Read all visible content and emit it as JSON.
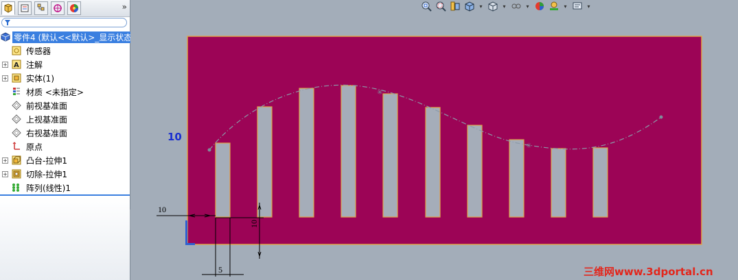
{
  "panel": {
    "tabs": [
      {
        "name": "featuremanager-tab-icon"
      },
      {
        "name": "propertymanager-tab-icon"
      },
      {
        "name": "configurationmanager-tab-icon"
      },
      {
        "name": "dimxpertmanager-tab-icon"
      },
      {
        "name": "displaymanager-tab-icon"
      }
    ],
    "more": "»",
    "tree": [
      {
        "label": "零件4 (默认<<默认>_显示状态",
        "icon": "part-icon",
        "selected": true,
        "expander": false
      },
      {
        "label": "传感器",
        "icon": "sensor-icon",
        "expander": false
      },
      {
        "label": "注解",
        "icon": "annotation-icon",
        "expander": true
      },
      {
        "label": "实体(1)",
        "icon": "solid-bodies-icon",
        "expander": true
      },
      {
        "label": "材质 <未指定>",
        "icon": "material-icon",
        "expander": false
      },
      {
        "label": "前视基准面",
        "icon": "plane-icon",
        "expander": false
      },
      {
        "label": "上视基准面",
        "icon": "plane-icon",
        "expander": false
      },
      {
        "label": "右视基准面",
        "icon": "plane-icon",
        "expander": false
      },
      {
        "label": "原点",
        "icon": "origin-icon",
        "expander": false
      },
      {
        "label": "凸台-拉伸1",
        "icon": "boss-extrude-icon",
        "expander": true
      },
      {
        "label": "切除-拉伸1",
        "icon": "cut-extrude-icon",
        "expander": true
      },
      {
        "label": "阵列(线性)1",
        "icon": "linear-pattern-icon",
        "expander": false
      }
    ]
  },
  "toolbar": {
    "icons": [
      "zoom-to-fit-icon",
      "zoom-area-icon",
      "previous-view-icon",
      "section-view-icon",
      "view-orientation-icon",
      "display-style-icon",
      "hide-show-icon",
      "edit-appearance-icon",
      "apply-scene-icon",
      "view-settings-icon"
    ]
  },
  "graphics": {
    "sketch_dimension_10": "10",
    "dims": {
      "left_offset": "10",
      "slot_height": "10",
      "slot_width": "5"
    },
    "colors": {
      "part_face": "#9c0456",
      "part_edge": "#e0a44a",
      "slot_fill": "#a5adb9",
      "curve": "#8b9aa8",
      "background": "#a3adb9"
    }
  },
  "watermark": "三维网www.3dportal.cn"
}
